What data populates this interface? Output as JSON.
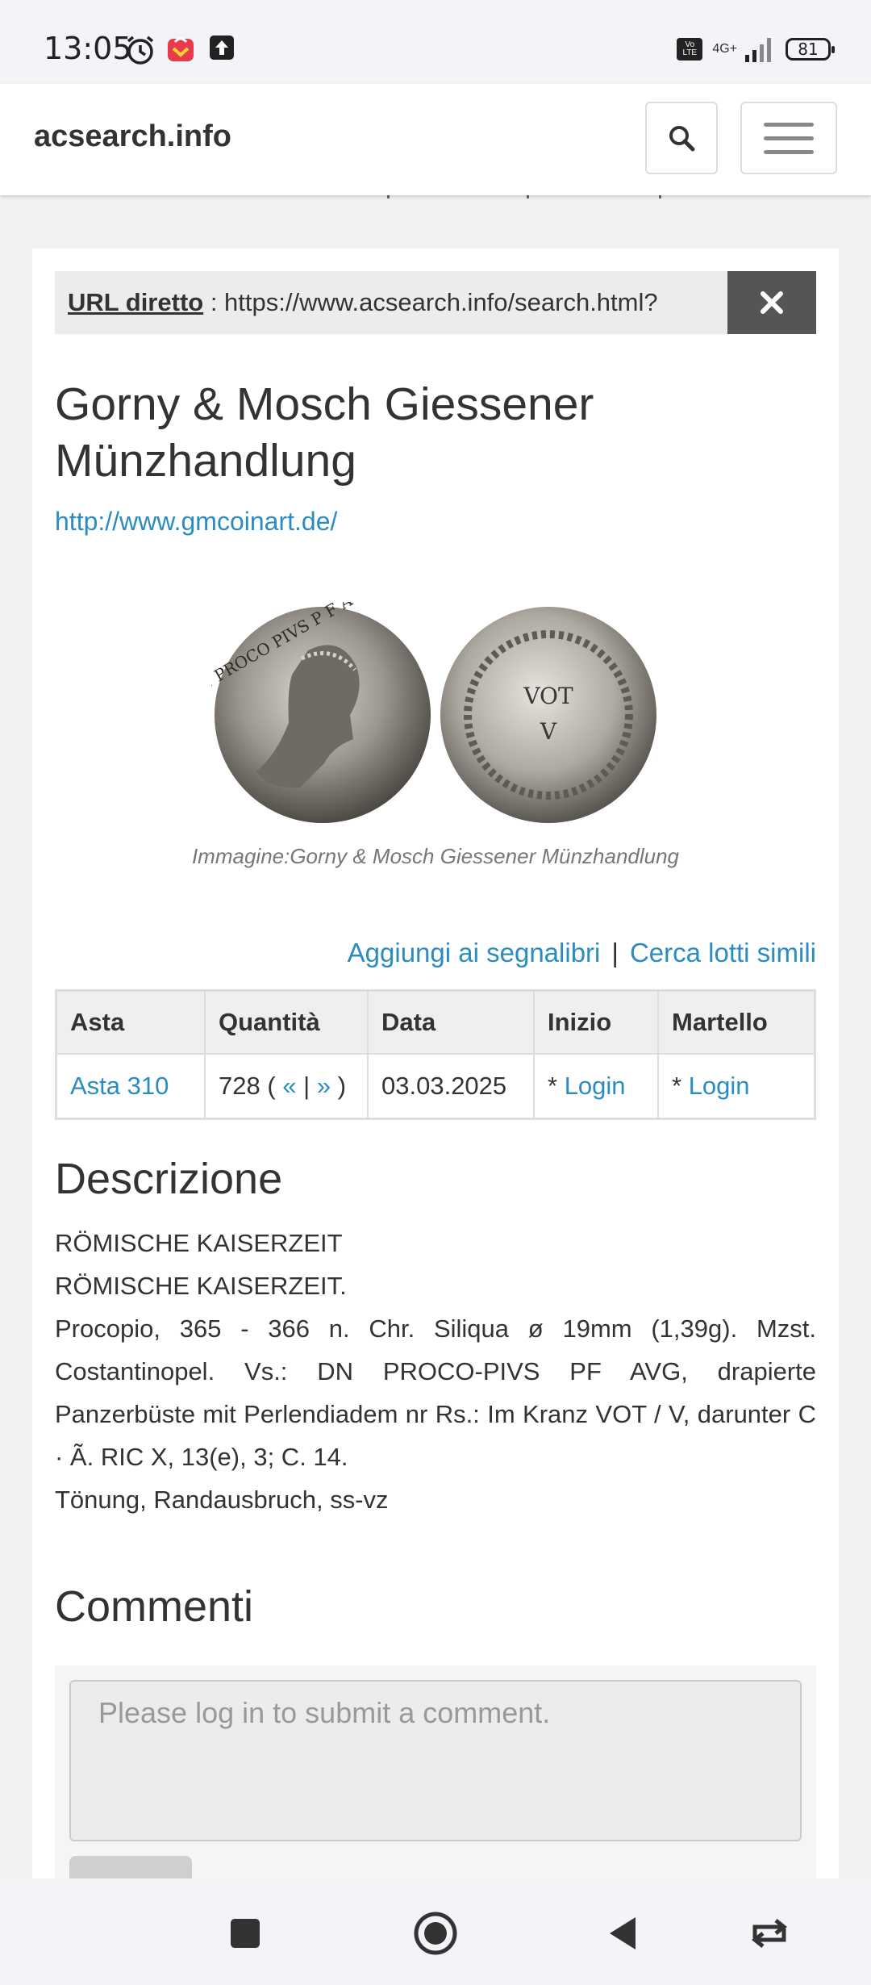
{
  "status_bar": {
    "time": "13:05",
    "network": "4G+",
    "volte": "Vo LTE",
    "battery": "81",
    "icons": [
      "alarm-icon",
      "shopping-app-icon",
      "upload-icon",
      "signal-icon",
      "battery-icon"
    ]
  },
  "navbar": {
    "brand": "acsearch.info",
    "icons": [
      "search-icon",
      "menu-icon"
    ]
  },
  "url_bar": {
    "label": "URL diretto",
    "separator": " : ",
    "url": "https://www.acsearch.info/search.html?"
  },
  "auction_house": {
    "name": "Gorny & Mosch Giessener Münzhandlung",
    "website": "http://www.gmcoinart.de/"
  },
  "image": {
    "caption": "Immagine:Gorny & Mosch Giessener Münzhandlung",
    "obverse_legend": "DN PROCO PIVS P F AVG",
    "reverse_text": [
      "VOT",
      "V"
    ]
  },
  "actions": {
    "bookmark": "Aggiungi ai segnalibri",
    "separator": "|",
    "similar": "Cerca lotti simili"
  },
  "lots_table": {
    "headers": [
      "Asta",
      "Quantità",
      "Data",
      "Inizio",
      "Martello"
    ],
    "row": {
      "auction": "Asta 310",
      "lot_number": "728 (",
      "prev": "«",
      "pipe": "|",
      "next": "»",
      "lot_close": " )",
      "date": "03.03.2025",
      "start_prefix": "* ",
      "start_link": "Login",
      "hammer_prefix": "* ",
      "hammer_link": "Login"
    }
  },
  "description": {
    "heading": "Descrizione",
    "lines": [
      "RÖMISCHE KAISERZEIT",
      "RÖMISCHE KAISERZEIT.",
      "Procopio, 365 - 366 n. Chr. Siliqua ø 19mm (1,39g). Mzst. Costantinopel. Vs.: DN PROCO-PIVS PF AVG, drapierte Panzerbüste mit Perlendiadem nr Rs.: Im Kranz VOT / V, darunter C · Ã. RIC X, 13(e), 3; C. 14.",
      "Tönung, Randausbruch, ss-vz"
    ]
  },
  "comments": {
    "heading": "Commenti",
    "placeholder": "Please log in to submit a comment."
  },
  "bottom_nav": [
    "recents-icon",
    "home-icon",
    "back-icon",
    "rotate-icon"
  ]
}
